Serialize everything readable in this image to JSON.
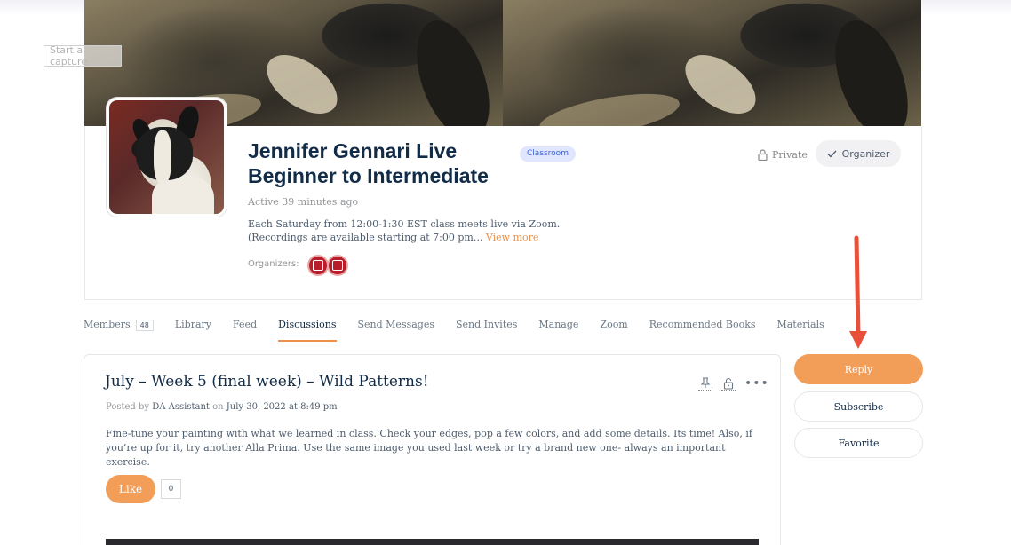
{
  "capture": {
    "label": "Start a capture"
  },
  "group": {
    "title": "Jennifer Gennari Live Beginner to Intermediate",
    "badge": "Classroom",
    "active": "Active 39 minutes ago",
    "description": "Each Saturday from 12:00-1:30 EST class meets live via Zoom. (Recordings are available starting at 7:00 pm...",
    "view_more": "View more",
    "organizers_label": "Organizers:",
    "privacy": "Private",
    "role_button": "Organizer"
  },
  "tabs": [
    {
      "label": "Members",
      "count": "48"
    },
    {
      "label": "Library"
    },
    {
      "label": "Feed"
    },
    {
      "label": "Discussions",
      "active": true
    },
    {
      "label": "Send Messages"
    },
    {
      "label": "Send Invites"
    },
    {
      "label": "Manage"
    },
    {
      "label": "Zoom"
    },
    {
      "label": "Recommended Books"
    },
    {
      "label": "Materials"
    }
  ],
  "post": {
    "title": "July – Week 5 (final week) – Wild Patterns!",
    "posted_by": "Posted by",
    "author": "DA Assistant",
    "on": "on",
    "date": "July 30, 2022 at 8:49 pm",
    "body": "Fine-tune your painting with what we learned in class. Check your edges, pop a few colors, and add some details. Its time! Also, if you’re up for it, try another Alla Prima. Use the same image you used last week or try a brand new one- always an important exercise.",
    "like_label": "Like",
    "like_count": "0"
  },
  "sidebar": {
    "reply": "Reply",
    "subscribe": "Subscribe",
    "favorite": "Favorite"
  },
  "colors": {
    "accent": "#f29d58",
    "title": "#122b46",
    "badge_bg": "#dfe6fd",
    "annotation_arrow": "#e8503a"
  },
  "icons": [
    "lock-icon",
    "check-icon",
    "pin-icon",
    "unlock-icon",
    "more-icon",
    "down-arrow-annotation"
  ]
}
